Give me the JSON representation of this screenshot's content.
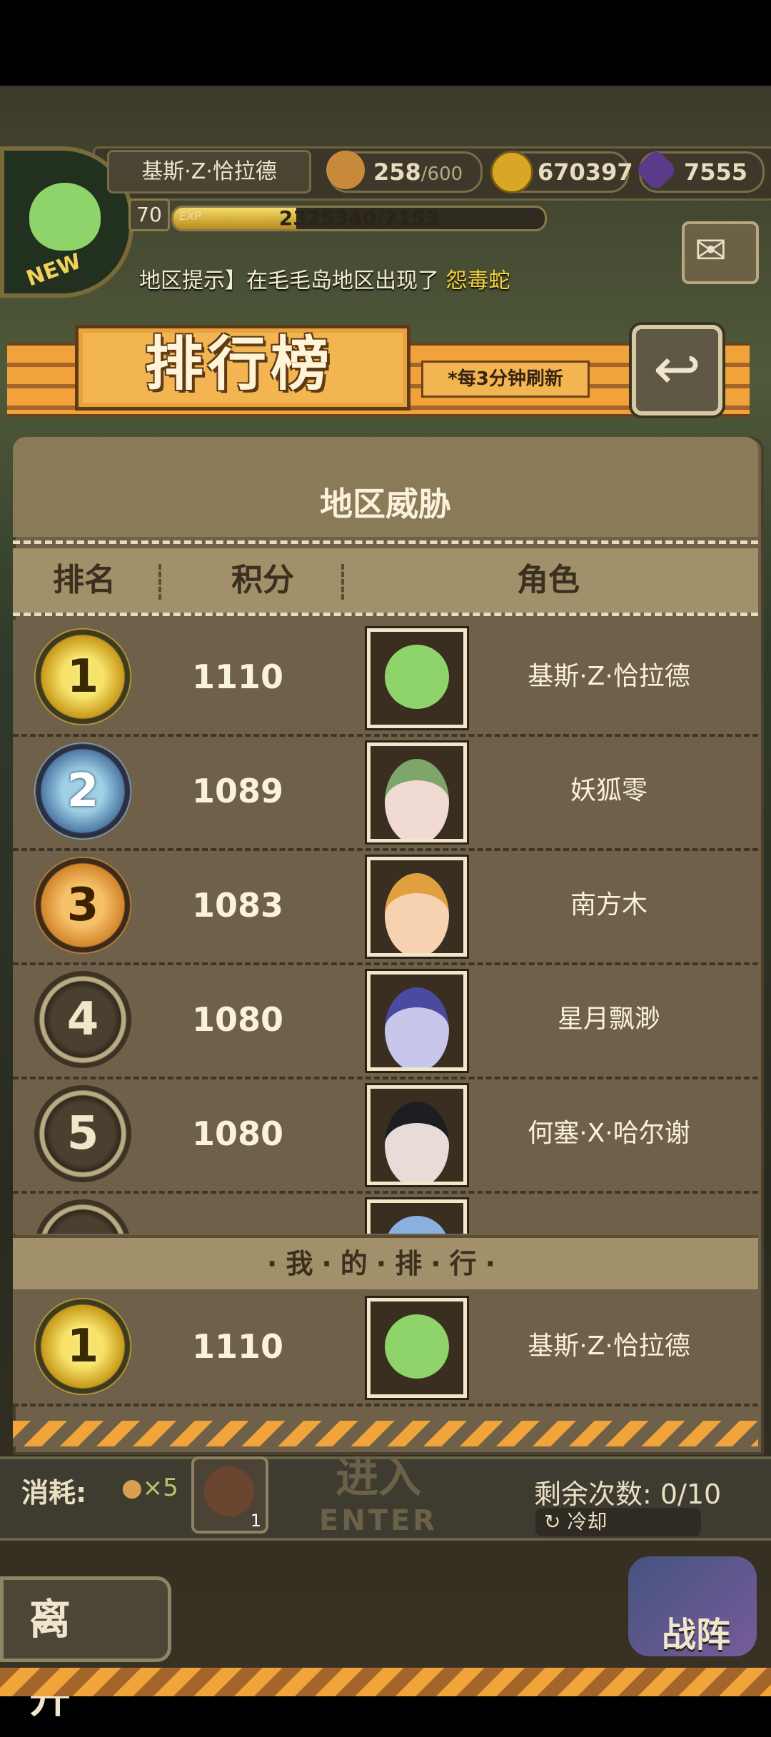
{
  "hud": {
    "player_name": "基斯·Z·恰拉德",
    "level": "70",
    "exp_label": "EXP",
    "exp_text": "2325340/7153",
    "exp_fraction": 0.33,
    "new_tag": "NEW",
    "bread": "258",
    "bread_max": "/600",
    "gold": "670397",
    "gems": "7555"
  },
  "notice": {
    "prefix": "地区提示】在毛毛岛地区出现了",
    "highlight": "怨毒蛇"
  },
  "banner": {
    "title": "排行榜",
    "note": "*每3分钟刷新"
  },
  "panel": {
    "title": "地区威胁",
    "columns": [
      "排名",
      "积分",
      "角色"
    ]
  },
  "rankings": [
    {
      "rank": "1",
      "score": "1110",
      "name": "基斯·Z·恰拉德",
      "medal": "gold"
    },
    {
      "rank": "2",
      "score": "1089",
      "name": "妖狐零",
      "medal": "silver"
    },
    {
      "rank": "3",
      "score": "1083",
      "name": "南方木",
      "medal": "bronze"
    },
    {
      "rank": "4",
      "score": "1080",
      "name": "星月飘渺",
      "medal": "plain"
    },
    {
      "rank": "5",
      "score": "1080",
      "name": "何塞·X·哈尔谢",
      "medal": "plain"
    }
  ],
  "my_rank": {
    "label": "·我·的·排·行·",
    "rank": "1",
    "score": "1110",
    "name": "基斯·Z·恰拉德"
  },
  "bottom": {
    "cost_label": "消耗:",
    "cost_value": "×5",
    "item_count": "1",
    "enter_cn": "进入",
    "enter_en": "ENTER",
    "remain": "剩余次数: 0/10",
    "cooldown": "冷却",
    "leave": "离开",
    "formation": "战阵"
  },
  "colors": {
    "accent": "#f2a23a",
    "panel": "#6e6049",
    "text_light": "#fbf2dc",
    "highlight": "#f3d23a"
  }
}
